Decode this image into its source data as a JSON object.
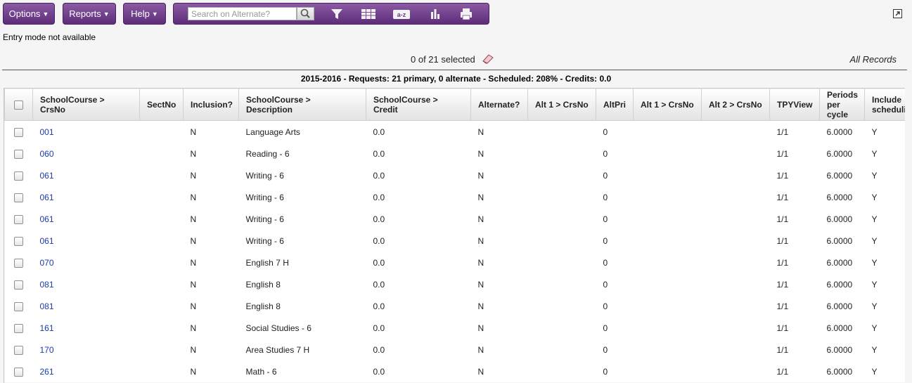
{
  "menus": {
    "options": "Options",
    "reports": "Reports",
    "help": "Help"
  },
  "search": {
    "placeholder": "Search on Alternate?"
  },
  "status": {
    "entry_mode": "Entry mode not available",
    "selected": "0 of 21 selected",
    "all_records": "All Records"
  },
  "summary": "2015-2016 - Requests: 21 primary, 0 alternate - Scheduled: 208% - Credits: 0.0",
  "columns": [
    "SchoolCourse > CrsNo",
    "SectNo",
    "Inclusion?",
    "SchoolCourse > Description",
    "SchoolCourse > Credit",
    "Alternate?",
    "Alt 1 > CrsNo",
    "AltPri",
    "Alt 1 > CrsNo",
    "Alt 2 > CrsNo",
    "TPYView",
    "Periods per cycle",
    "Include scheduling"
  ],
  "rows": [
    {
      "crsno": "001",
      "sectno": "",
      "inclusion": "N",
      "description": "Language Arts",
      "credit": "0.0",
      "alternate": "N",
      "alt1": "",
      "altpri": "0",
      "alt1b": "",
      "alt2": "",
      "tpy": "1/1",
      "periods": "6.0000",
      "include": "Y"
    },
    {
      "crsno": "060",
      "sectno": "",
      "inclusion": "N",
      "description": "Reading - 6",
      "credit": "0.0",
      "alternate": "N",
      "alt1": "",
      "altpri": "0",
      "alt1b": "",
      "alt2": "",
      "tpy": "1/1",
      "periods": "6.0000",
      "include": "Y"
    },
    {
      "crsno": "061",
      "sectno": "",
      "inclusion": "N",
      "description": "Writing - 6",
      "credit": "0.0",
      "alternate": "N",
      "alt1": "",
      "altpri": "0",
      "alt1b": "",
      "alt2": "",
      "tpy": "1/1",
      "periods": "6.0000",
      "include": "Y"
    },
    {
      "crsno": "061",
      "sectno": "",
      "inclusion": "N",
      "description": "Writing - 6",
      "credit": "0.0",
      "alternate": "N",
      "alt1": "",
      "altpri": "0",
      "alt1b": "",
      "alt2": "",
      "tpy": "1/1",
      "periods": "6.0000",
      "include": "Y"
    },
    {
      "crsno": "061",
      "sectno": "",
      "inclusion": "N",
      "description": "Writing - 6",
      "credit": "0.0",
      "alternate": "N",
      "alt1": "",
      "altpri": "0",
      "alt1b": "",
      "alt2": "",
      "tpy": "1/1",
      "periods": "6.0000",
      "include": "Y"
    },
    {
      "crsno": "061",
      "sectno": "",
      "inclusion": "N",
      "description": "Writing - 6",
      "credit": "0.0",
      "alternate": "N",
      "alt1": "",
      "altpri": "0",
      "alt1b": "",
      "alt2": "",
      "tpy": "1/1",
      "periods": "6.0000",
      "include": "Y"
    },
    {
      "crsno": "070",
      "sectno": "",
      "inclusion": "N",
      "description": "English 7 H",
      "credit": "0.0",
      "alternate": "N",
      "alt1": "",
      "altpri": "0",
      "alt1b": "",
      "alt2": "",
      "tpy": "1/1",
      "periods": "6.0000",
      "include": "Y"
    },
    {
      "crsno": "081",
      "sectno": "",
      "inclusion": "N",
      "description": "English 8",
      "credit": "0.0",
      "alternate": "N",
      "alt1": "",
      "altpri": "0",
      "alt1b": "",
      "alt2": "",
      "tpy": "1/1",
      "periods": "6.0000",
      "include": "Y"
    },
    {
      "crsno": "081",
      "sectno": "",
      "inclusion": "N",
      "description": "English 8",
      "credit": "0.0",
      "alternate": "N",
      "alt1": "",
      "altpri": "0",
      "alt1b": "",
      "alt2": "",
      "tpy": "1/1",
      "periods": "6.0000",
      "include": "Y"
    },
    {
      "crsno": "161",
      "sectno": "",
      "inclusion": "N",
      "description": "Social Studies - 6",
      "credit": "0.0",
      "alternate": "N",
      "alt1": "",
      "altpri": "0",
      "alt1b": "",
      "alt2": "",
      "tpy": "1/1",
      "periods": "6.0000",
      "include": "Y"
    },
    {
      "crsno": "170",
      "sectno": "",
      "inclusion": "N",
      "description": "Area Studies 7 H",
      "credit": "0.0",
      "alternate": "N",
      "alt1": "",
      "altpri": "0",
      "alt1b": "",
      "alt2": "",
      "tpy": "1/1",
      "periods": "6.0000",
      "include": "Y"
    },
    {
      "crsno": "261",
      "sectno": "",
      "inclusion": "N",
      "description": "Math - 6",
      "credit": "0.0",
      "alternate": "N",
      "alt1": "",
      "altpri": "0",
      "alt1b": "",
      "alt2": "",
      "tpy": "1/1",
      "periods": "6.0000",
      "include": "Y"
    }
  ],
  "icons": {
    "search": "search-icon",
    "filter": "filter-icon",
    "grid": "grid-view-icon",
    "sort": "sort-az-icon",
    "chart": "bar-chart-icon",
    "print": "print-icon",
    "maximize": "maximize-icon",
    "eraser": "eraser-icon"
  },
  "colors": {
    "brand_purple": "#6b3a8a",
    "link": "#1a3aa8"
  }
}
